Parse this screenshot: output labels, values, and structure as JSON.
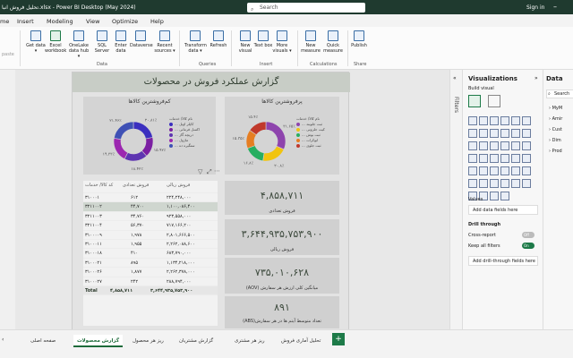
{
  "window": {
    "title": "تحلیل فروش انبا.xlsx - Power BI Desktop (May 2024)",
    "search_placeholder": "Search",
    "signin": "Sign in"
  },
  "menu": [
    "me",
    "Insert",
    "Modeling",
    "View",
    "Optimize",
    "Help"
  ],
  "ribbon": {
    "buttons": [
      {
        "label": "Get data ▾"
      },
      {
        "label": "Excel workbook"
      },
      {
        "label": "OneLake data hub ▾"
      },
      {
        "label": "SQL Server"
      },
      {
        "label": "Enter data"
      },
      {
        "label": "Dataverse"
      },
      {
        "label": "Recent sources ▾"
      },
      {
        "label": "Transform data ▾"
      },
      {
        "label": "Refresh"
      },
      {
        "label": "New visual"
      },
      {
        "label": "Text box"
      },
      {
        "label": "More visuals ▾"
      },
      {
        "label": "New measure"
      },
      {
        "label": "Quick measure"
      },
      {
        "label": "Publish"
      }
    ],
    "groups": [
      "Data",
      "Queries",
      "Insert",
      "Calculations",
      "Share"
    ],
    "paste_hint": "paste"
  },
  "report": {
    "title": "گزارش عملکرد فروش در محصولات",
    "top_chart": {
      "title": "پرفروشترین کالاها",
      "legend_title": "نام کالا/ خدمات",
      "legend": [
        "... ثبت جلوبند",
        "... کیت حلزونی",
        "... ثبت بوش",
        "... ابوکرات",
        "... ثبت جلوی"
      ],
      "colors": [
        "#8e44ad",
        "#f1c40f",
        "#27ae60",
        "#e67e22",
        "#c0392b"
      ],
      "values": [
        31.65,
        20.8,
        16.8,
        15.35,
        15.4
      ],
      "labels": [
        "۳۱.۶۵٪",
        "۲۰.۸٪",
        "۱۶.۸٪",
        "۱۵.۳۵٪",
        "۱۵.۴٪"
      ]
    },
    "bottom_chart": {
      "title": "کم‌فروشترین کالاها",
      "legend_title": "نام کالا/ خدمات",
      "legend": [
        "... کاپلر اویل",
        "... اکسل فرمانی",
        "... دریچه گاز",
        "... ماژول",
        "... ستگیره ده"
      ],
      "colors": [
        "#3b2fbf",
        "#7b1fa2",
        "#5e35b1",
        "#9c27b0",
        "#3f51b5"
      ],
      "values": [
        20.81,
        15.92,
        18.32,
        19.33,
        21.46
      ],
      "labels": [
        "۲۰.۸۱٪",
        "۱۵.۹۲٪",
        "۱۸.۴۲٪",
        "۱۹.۳۳٪",
        "۲۱.۴۶٪"
      ]
    },
    "table": {
      "headers": [
        "فروش ریالی",
        "فروش تعدادی",
        "کد کالا/ خدمات"
      ],
      "rows": [
        [
          "۲۲۴,۲۴۸,۰۰۰",
          "۶۱۲",
          "۳۱۰۰۰۱"
        ],
        [
          "۱,۱۰۰,۰۸۶,۴۰۰",
          "۴۴,۷۰۰",
          "۳۲۱۱۰۰۲"
        ],
        [
          "۹۲۳,۵۵۸,۰۰۰",
          "۳۴,۷۶۰",
          "۳۲۱۱۰۰۳"
        ],
        [
          "۷۱۷,۱۶۶,۲۰۰",
          "۵۶,۳۷۰",
          "۳۲۱۱۰۰۴"
        ],
        [
          "۲,۸۰۱,۶۶۶,۵۰۰",
          "۱,۹۷۸",
          "۳۱۰۰۰۰۹"
        ],
        [
          "۲,۲۶۲,۰۸۸,۶۰۰",
          "۱,۹۵۵",
          "۳۱۰۰۰۱۱"
        ],
        [
          "۶۸۳,۷۹۰,۰۰۰",
          "۴۱۰",
          "۳۱۰۰۰۱۸"
        ],
        [
          "۱,۱۳۴,۲۱۸,۰۰۰",
          "۸۹۵",
          "۳۱۰۰۰۲۱"
        ],
        [
          "۲,۲۶۲,۳۷۸,۰۰۰",
          "۱,۸۷۷",
          "۳۱۰۰۰۲۶"
        ],
        [
          "۲۸۸,۷۹۴,۰۰۰",
          "۲۴۲",
          "۳۱۰۰۰۲۷"
        ]
      ],
      "total_label": "Total",
      "total_qty": "۴,۸۵۸,۷۱۱",
      "total_amount": "۳,۶۴۴,۹۳۵,۷۵۳,۹۰۰"
    },
    "cards": [
      {
        "value": "۴,۸۵۸,۷۱۱",
        "label": "فروش تعدادی"
      },
      {
        "value": "۳,۶۴۴,۹۳۵,۷۵۳,۹۰۰",
        "label": "فروش ریالی"
      },
      {
        "value": "۷۳۵,۰۱۰,۶۲۸",
        "label": "(AOV) میانگین کلی ارزش هر سفارش"
      },
      {
        "value": "۸۹۱",
        "label": "(ABS)تعداد متوسط آیتم ها در هر سفارش"
      }
    ]
  },
  "tabs": [
    "صفحه اصلی",
    "گزارش محصولات",
    "ریز هر محصول",
    "گزارش مشتریان",
    "ریز هر مشتری",
    "تحلیل آماری فروش"
  ],
  "active_tab": "گزارش محصولات",
  "add_tab": "+",
  "panes": {
    "filters": "Filters",
    "viz_title": "Visualizations",
    "build_visual": "Build visual",
    "values": "Values",
    "add_data_fields": "Add data fields here",
    "drill_through": "Drill through",
    "cross_report": "Cross-report",
    "cross_report_state": "Off",
    "keep_all_filters": "Keep all filters",
    "keep_state": "On",
    "add_drill_fields": "Add drill-through fields here",
    "data_title": "Data",
    "data_search": "Search",
    "data_items": [
      "MyM",
      "Amir",
      "Cust",
      "Dim",
      "Prod"
    ]
  }
}
